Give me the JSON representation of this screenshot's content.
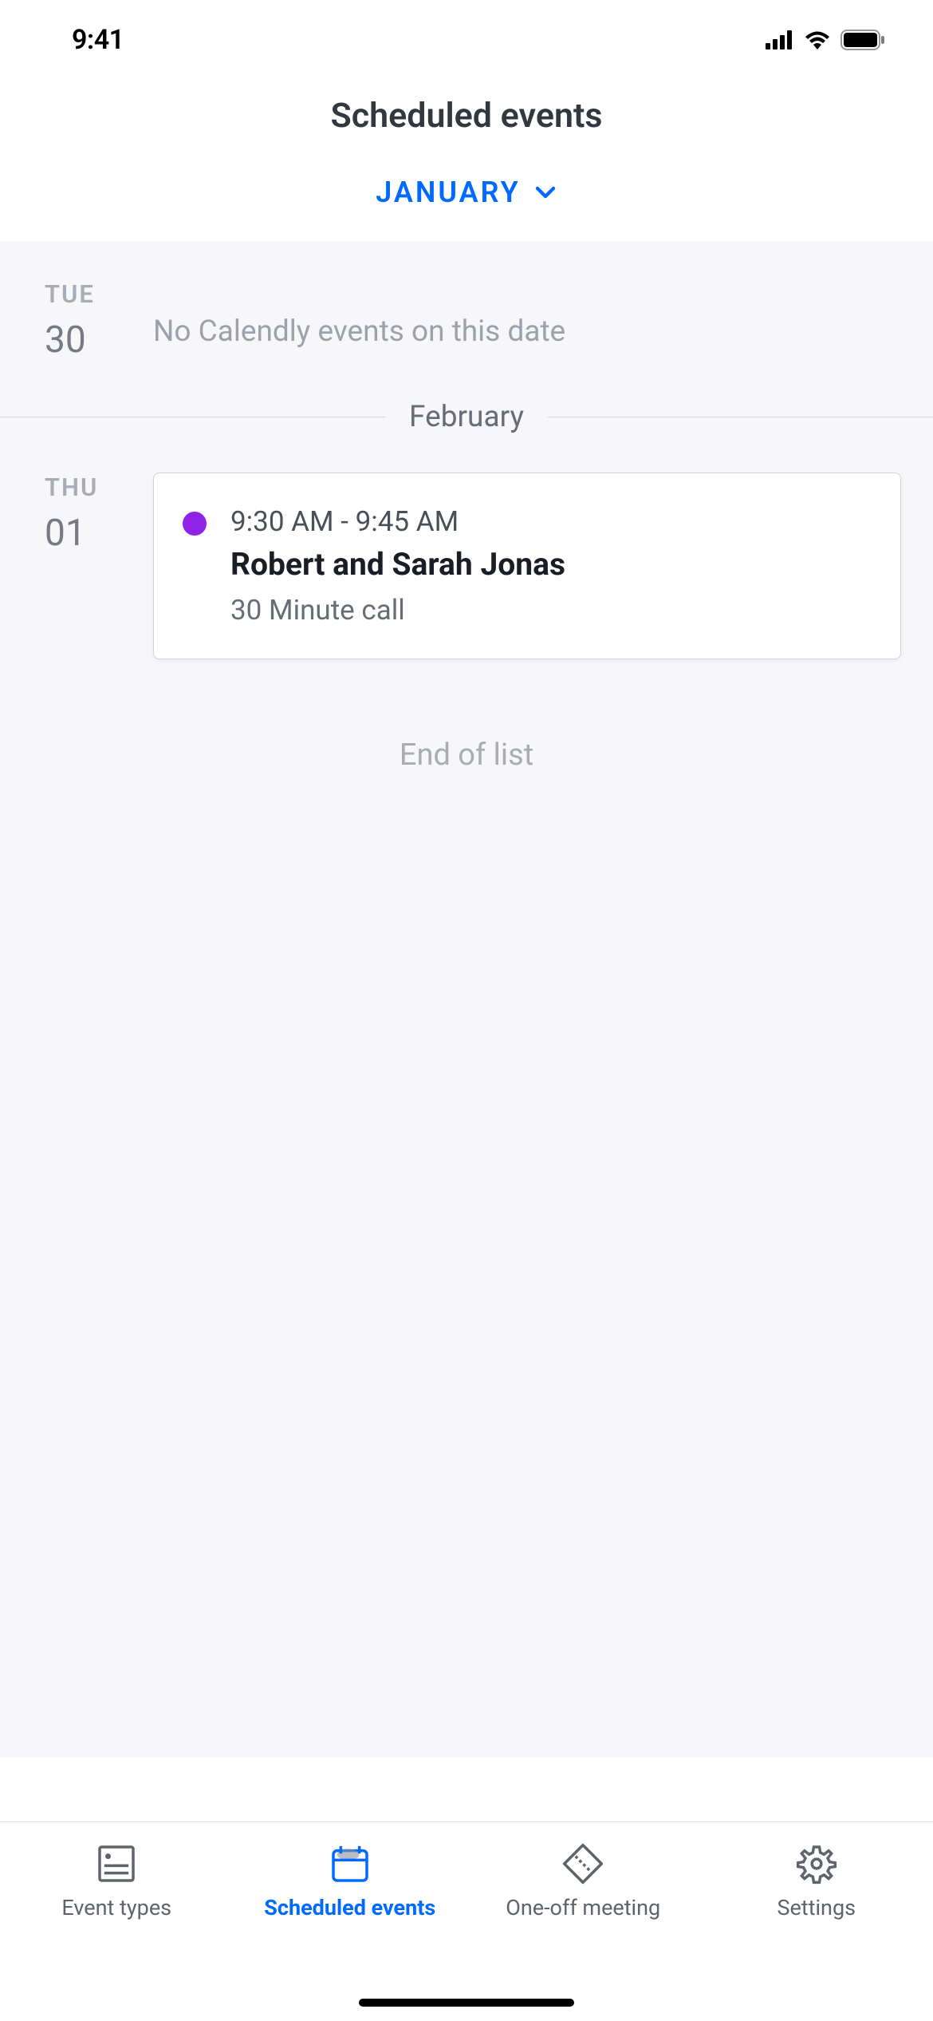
{
  "status": {
    "time": "9:41"
  },
  "header": {
    "title": "Scheduled events",
    "month": "JANUARY"
  },
  "days": [
    {
      "dayName": "TUE",
      "dayNum": "30",
      "empty": "No Calendly events on this date"
    }
  ],
  "monthDivider": "February",
  "events": [
    {
      "dayName": "THU",
      "dayNum": "01",
      "time": "9:30 AM - 9:45 AM",
      "title": "Robert and Sarah Jonas",
      "type": "30 Minute call",
      "dotColor": "#8e24e6"
    }
  ],
  "endOfList": "End of list",
  "tabs": [
    {
      "label": "Event types"
    },
    {
      "label": "Scheduled events"
    },
    {
      "label": "One-off meeting"
    },
    {
      "label": "Settings"
    }
  ]
}
